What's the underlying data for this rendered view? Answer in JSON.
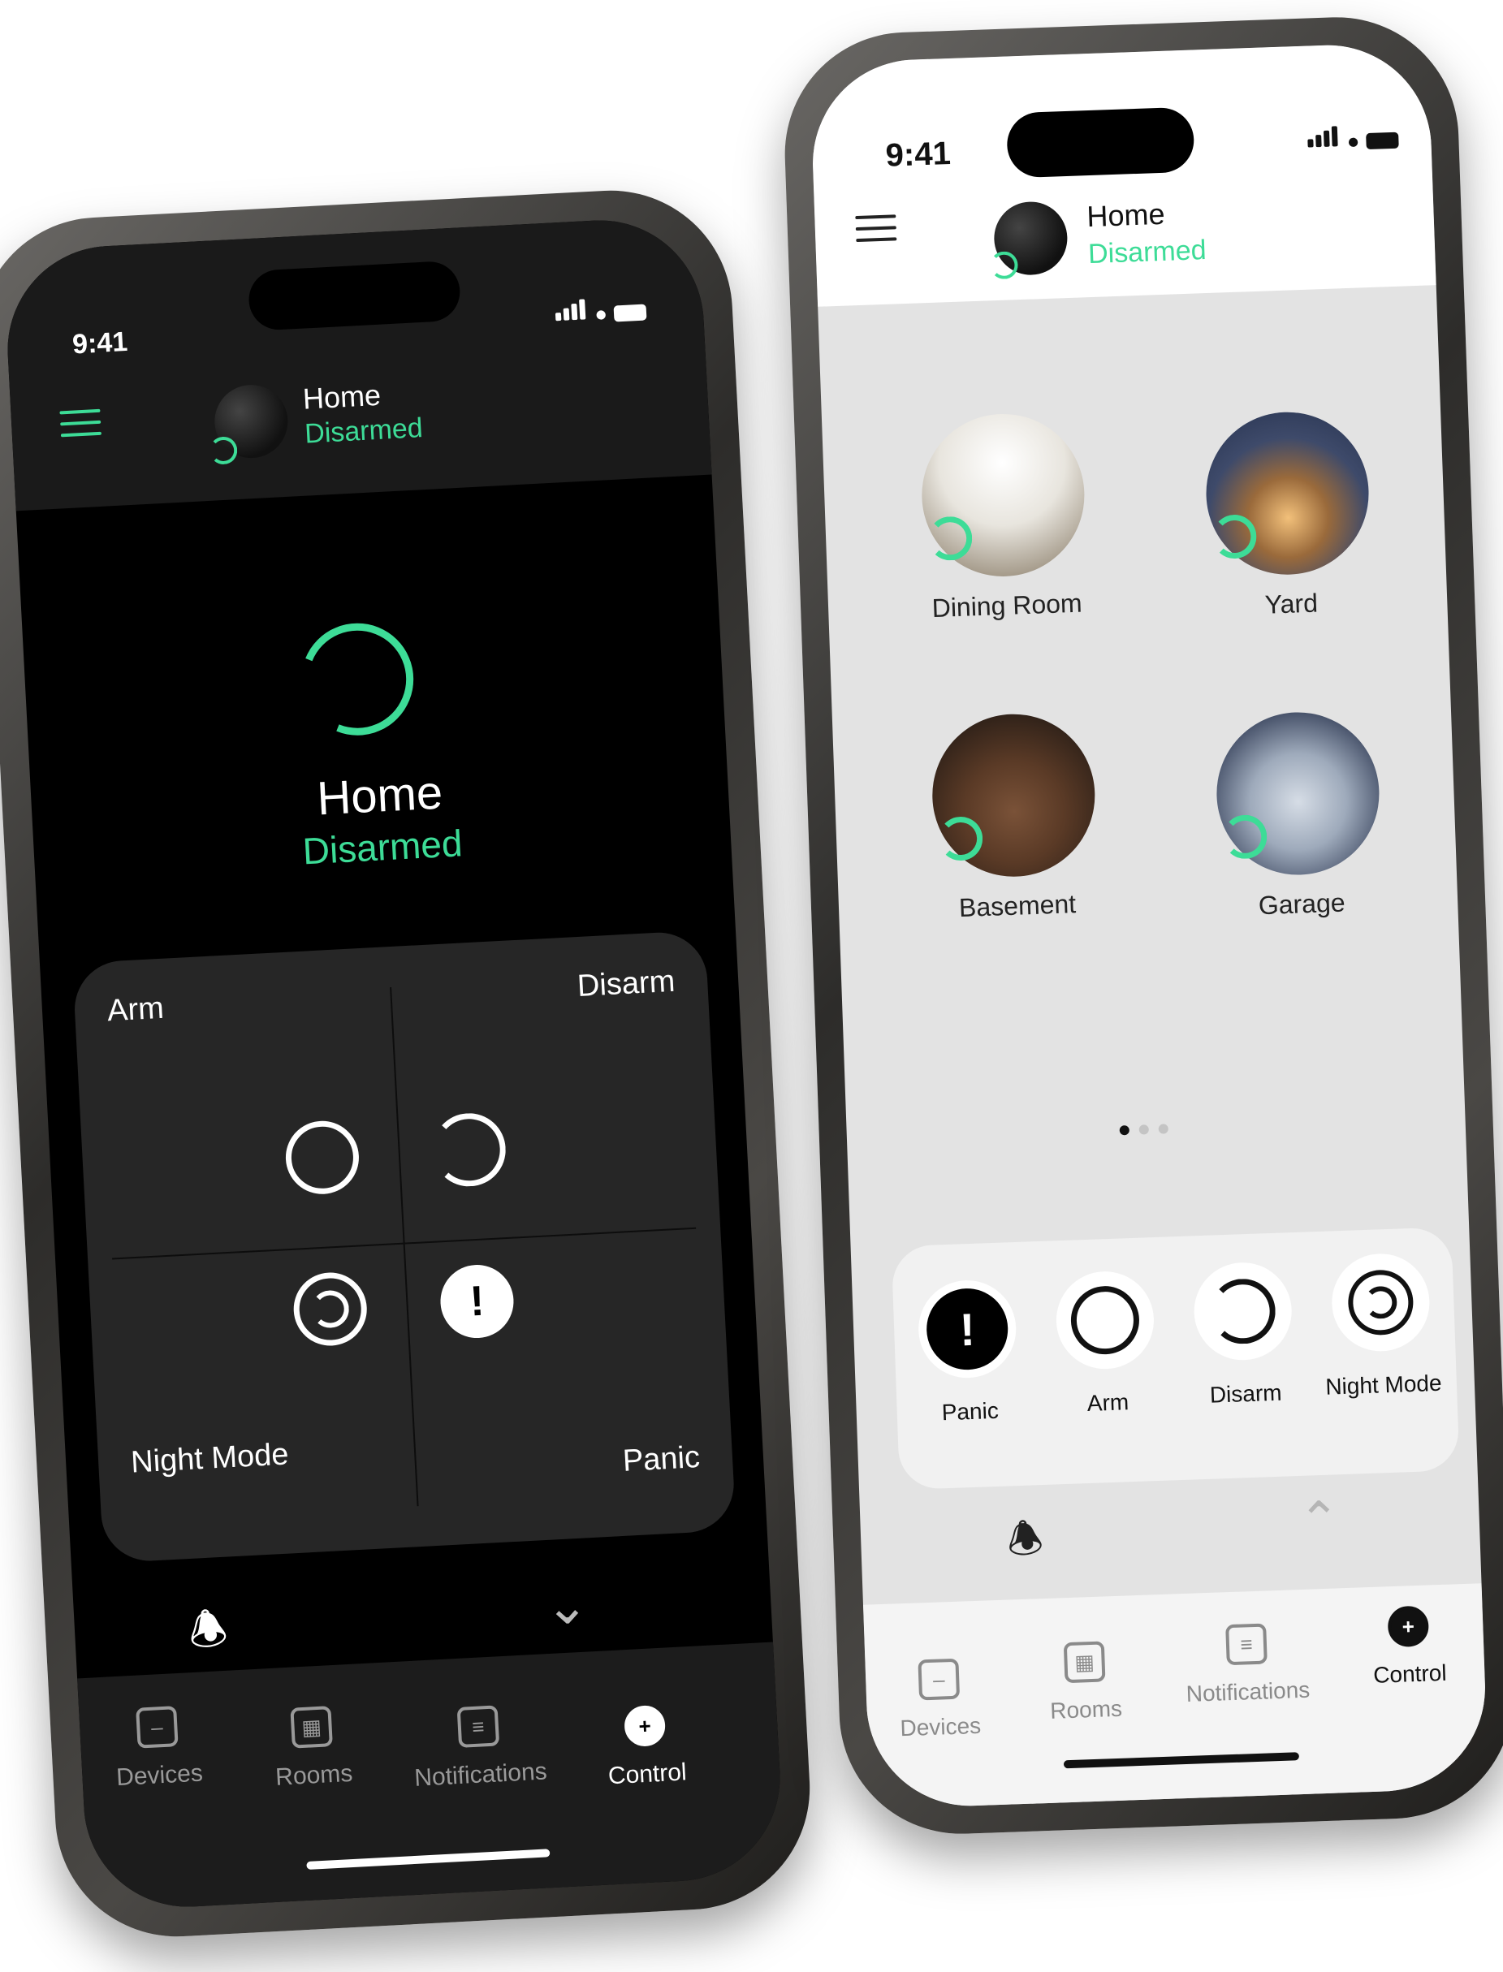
{
  "dark_phone": {
    "status_bar": {
      "time": "9:41"
    },
    "header": {
      "title": "Home",
      "status": "Disarmed"
    },
    "hero": {
      "title": "Home",
      "status": "Disarmed"
    },
    "control_panel": {
      "arm_label": "Arm",
      "disarm_label": "Disarm",
      "night_mode_label": "Night Mode",
      "panic_label": "Panic",
      "panic_glyph": "!"
    },
    "bottom_nav": [
      {
        "label": "Devices",
        "icon": "devices-icon",
        "active": false
      },
      {
        "label": "Rooms",
        "icon": "rooms-icon",
        "active": false
      },
      {
        "label": "Notifications",
        "icon": "notifications-icon",
        "active": false
      },
      {
        "label": "Control",
        "icon": "control-icon",
        "active": true,
        "glyph": "+"
      }
    ]
  },
  "light_phone": {
    "status_bar": {
      "time": "9:41"
    },
    "header": {
      "title": "Home",
      "status": "Disarmed"
    },
    "rooms": [
      {
        "name": "Dining Room"
      },
      {
        "name": "Yard"
      },
      {
        "name": "Basement"
      },
      {
        "name": "Garage"
      }
    ],
    "pagination": {
      "pages": 3,
      "current": 1
    },
    "quick_actions": [
      {
        "label": "Panic",
        "icon": "panic-icon",
        "glyph": "!"
      },
      {
        "label": "Arm",
        "icon": "arm-icon"
      },
      {
        "label": "Disarm",
        "icon": "disarm-icon"
      },
      {
        "label": "Night Mode",
        "icon": "night-mode-icon"
      }
    ],
    "bottom_nav": [
      {
        "label": "Devices",
        "icon": "devices-icon",
        "active": false
      },
      {
        "label": "Rooms",
        "icon": "rooms-icon",
        "active": false
      },
      {
        "label": "Notifications",
        "icon": "notifications-icon",
        "active": false
      },
      {
        "label": "Control",
        "icon": "control-icon",
        "active": true,
        "glyph": "+"
      }
    ]
  },
  "theme": {
    "accent": "#3ddc97",
    "dark_bg": "#000000",
    "dark_panel": "#262626",
    "light_bg": "#e3e3e3",
    "light_card": "#f1f1f1"
  }
}
